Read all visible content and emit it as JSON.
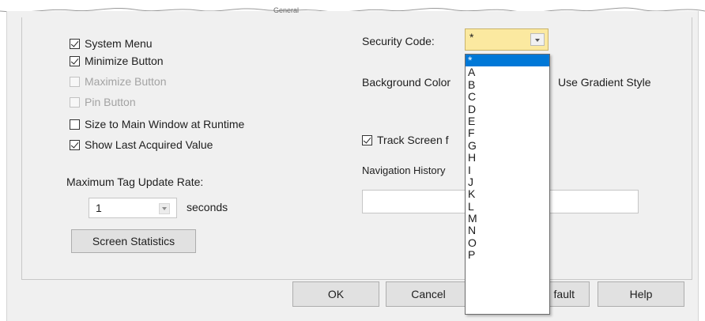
{
  "tab_label": "General",
  "left_options": [
    {
      "label": "System Menu",
      "checked": true,
      "enabled": true
    },
    {
      "label": "Minimize Button",
      "checked": true,
      "enabled": true
    },
    {
      "label": "Maximize Button",
      "checked": false,
      "enabled": false
    },
    {
      "label": "Pin Button",
      "checked": false,
      "enabled": false
    },
    {
      "label": "Size to Main Window at Runtime",
      "checked": false,
      "enabled": true
    },
    {
      "label": "Show Last Acquired Value",
      "checked": true,
      "enabled": true
    }
  ],
  "tag_update": {
    "label": "Maximum Tag Update Rate:",
    "value": "1",
    "unit": "seconds"
  },
  "screen_statistics_button": "Screen Statistics",
  "security": {
    "label": "Security Code:",
    "value": "*",
    "options": [
      "*",
      "A",
      "B",
      "C",
      "D",
      "E",
      "F",
      "G",
      "H",
      "I",
      "J",
      "K",
      "L",
      "M",
      "N",
      "O",
      "P"
    ],
    "selected_index": 0
  },
  "background_color_label": "Background Color",
  "gradient_label": "Use Gradient Style",
  "track_screen": {
    "label": "Track Screen f",
    "checked": true
  },
  "navigation_history_label": "Navigation History",
  "navigation_history_value": "",
  "footer": {
    "ok": "OK",
    "cancel": "Cancel",
    "default": "fault",
    "help": "Help"
  },
  "colors": {
    "combo_bg": "#fbe9a0",
    "selection": "#0078d7",
    "dialog_bg": "#f0f0f0"
  }
}
